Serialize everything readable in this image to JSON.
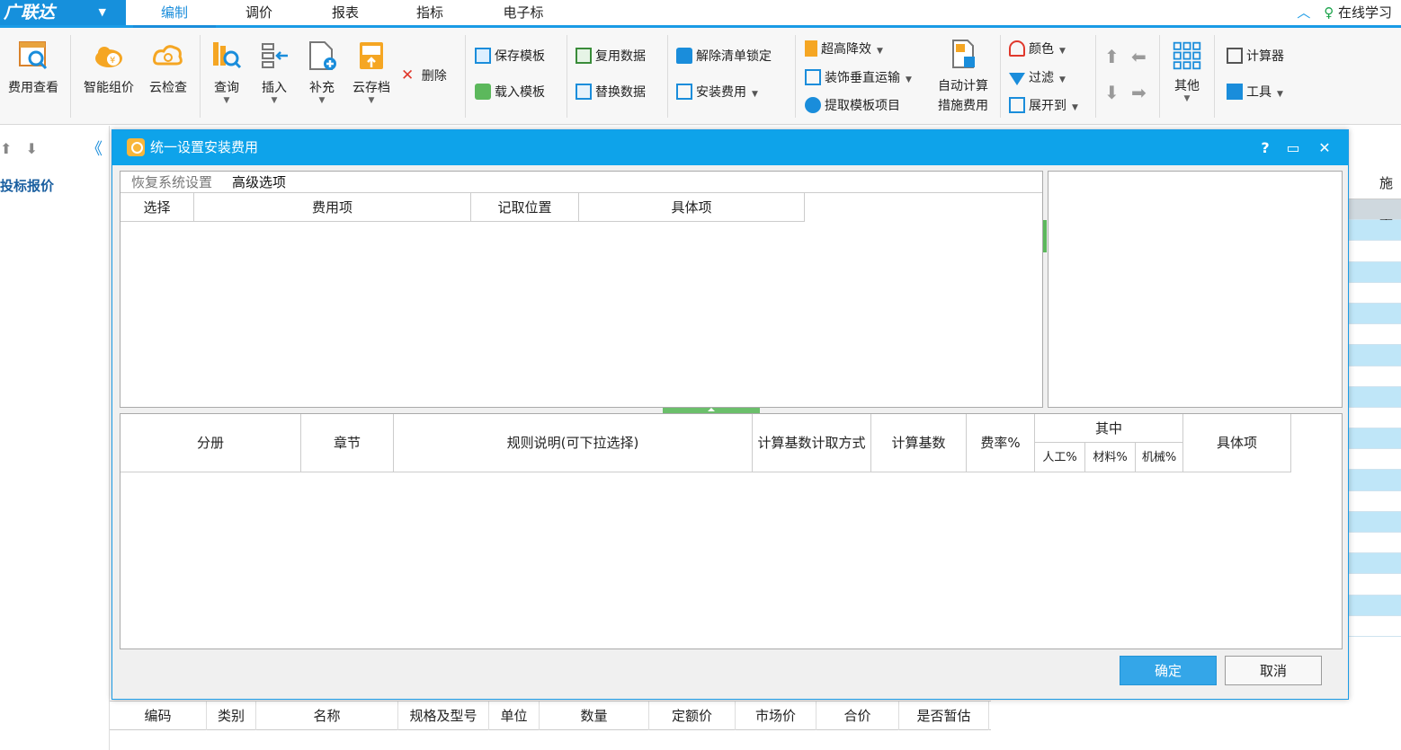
{
  "app": {
    "brand": "广联达",
    "brand_caret": "▼"
  },
  "menu": {
    "tabs": [
      {
        "label": "编制",
        "active": true
      },
      {
        "label": "调价"
      },
      {
        "label": "报表"
      },
      {
        "label": "指标"
      },
      {
        "label": "电子标"
      }
    ],
    "online_label": "在线学习"
  },
  "ribbon": {
    "fee_view": "费用查看",
    "smart_price": "智能组价",
    "cloud_check": "云检查",
    "query": "查询",
    "insert": "插入",
    "supplement": "补充",
    "cloud_archive": "云存档",
    "delete": "删除",
    "save_template": "保存模板",
    "load_template": "载入模板",
    "reuse_data": "复用数据",
    "replace_data": "替换数据",
    "unlock_list": "解除清单锁定",
    "install_fee": "安装费用",
    "high_rise": "超高降效",
    "vertical_transport": "装饰垂直运输",
    "extract_template": "提取模板项目",
    "auto_calc_line1": "自动计算",
    "auto_calc_line2": "措施费用",
    "color": "颜色",
    "filter": "过滤",
    "expand_to": "展开到",
    "other": "其他",
    "calculator": "计算器",
    "tools": "工具"
  },
  "left_panel": {
    "tree_root": "投标报价"
  },
  "background": {
    "right_header": "施工",
    "bottom_columns": [
      "编码",
      "类别",
      "名称",
      "规格及型号",
      "单位",
      "数量",
      "定额价",
      "市场价",
      "合价",
      "是否暂估"
    ]
  },
  "dialog": {
    "title": "统一设置安装费用",
    "help": "?",
    "maximize": "▭",
    "close": "✕",
    "tab_restore": "恢复系统设置",
    "tab_advanced": "高级选项",
    "upper_columns": [
      "选择",
      "费用项",
      "记取位置",
      "具体项"
    ],
    "lower_columns": {
      "volume": "分册",
      "chapter": "章节",
      "rule": "规则说明(可下拉选择)",
      "calc_method": "计算基数计取方式",
      "calc_base": "计算基数",
      "rate": "费率%",
      "among": "其中",
      "labor": "人工%",
      "material": "材料%",
      "machine": "机械%",
      "specific": "具体项"
    },
    "ok": "确定",
    "cancel": "取消"
  },
  "colors": {
    "accent": "#0ea3ea",
    "brand": "#1690dc",
    "ok_button": "#34a6e8",
    "splitter": "#5cb85c"
  }
}
